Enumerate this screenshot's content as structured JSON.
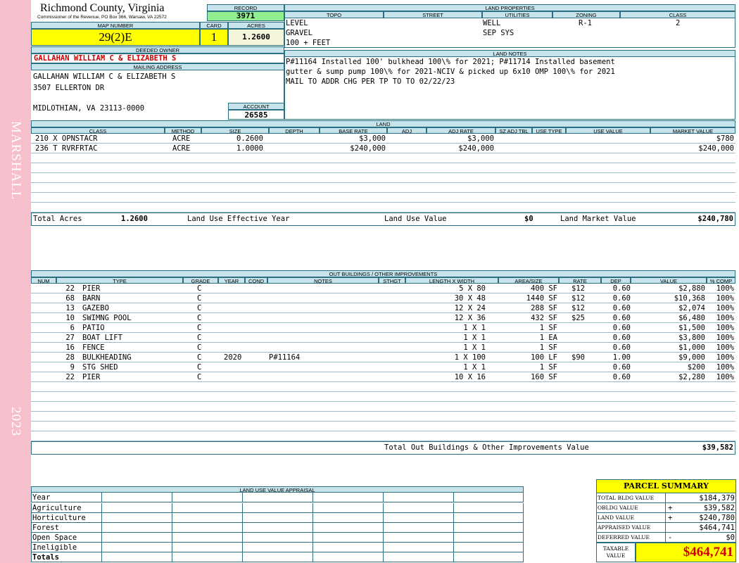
{
  "side": {
    "top_text": "MARSHALL",
    "bottom_text": "2023"
  },
  "header": {
    "county": "Richmond County, Virginia",
    "commissioner": "Commissioner of the Revenue, PO Box 366, Warsaw, VA 22572",
    "record_label": "RECORD",
    "record": "3971",
    "map_number_label": "MAP NUMBER",
    "map_number": "29(2)E",
    "card_label": "CARD",
    "card": "1",
    "acres_label": "ACRES",
    "acres": "1.2600"
  },
  "owner": {
    "deeded_label": "DEEDED OWNER",
    "deeded": "GALLAHAN WILLIAM C & ELIZABETH S",
    "mailing_label": "MAILING ADDRESS",
    "line1": "GALLAHAN WILLIAM C & ELIZABETH S",
    "line2": "3507 ELLERTON DR",
    "line3": "MIDLOTHIAN, VA 23113-0000",
    "account_label": "ACCOUNT",
    "account": "26585"
  },
  "land_properties": {
    "title": "LAND PROPERTIES",
    "headers": [
      "TOPO",
      "STREET",
      "UTILITIES",
      "ZONING",
      "CLASS"
    ],
    "topo": [
      "LEVEL",
      "GRAVEL",
      "100 + FEET"
    ],
    "utilities": [
      "WELL",
      "SEP SYS"
    ],
    "zoning": "R-1",
    "class": "2"
  },
  "land_notes": {
    "title": "LAND NOTES",
    "lines": [
      "P#11164 Installed 100' bulkhead 100\\% for 2021; P#11714 Installed basement",
      "gutter & sump pump 100\\% for 2021-NCIV & picked up 6x10 OMP 100\\% for 2021",
      "MAIL TO ADDR CHG PER TP TO TO 02/22/23"
    ]
  },
  "land": {
    "title": "LAND",
    "headers": [
      "CLASS",
      "METHOD",
      "SIZE",
      "DEPTH",
      "BASE RATE",
      "ADJ",
      "ADJ RATE",
      "SZ ADJ TBL",
      "USE TYPE",
      "USE VALUE",
      "MARKET VALUE"
    ],
    "rows": [
      {
        "class": "210 X OPNSTACR",
        "method": "ACRE",
        "size": "0.2600",
        "base_rate": "$3,000",
        "adj_rate": "$3,000",
        "market": "$780"
      },
      {
        "class": "236 T RVRFRTAC",
        "method": "ACRE",
        "size": "1.0000",
        "base_rate": "$240,000",
        "adj_rate": "$240,000",
        "market": "$240,000"
      }
    ],
    "total_acres_label": "Total Acres",
    "total_acres": "1.2600",
    "effective_label": "Land Use Effective Year",
    "use_value_label": "Land Use Value",
    "use_value": "$0",
    "market_label": "Land Market Value",
    "market_value": "$240,780"
  },
  "outbuildings": {
    "title": "OUT BUILDINGS / OTHER IMPROVEMENTS",
    "headers": [
      "NUM",
      "TYPE",
      "GRADE",
      "YEAR",
      "COND",
      "NOTES",
      "STHGT",
      "LENGTH X WIDTH",
      "AREA/SIZE",
      "RATE",
      "DEP",
      "VALUE",
      "% COMP"
    ],
    "rows": [
      {
        "num": "22",
        "type": "PIER",
        "grade": "C",
        "year": "",
        "notes": "",
        "lw": "5 X 80",
        "area": "400 SF",
        "rate": "$12",
        "dep": "0.60",
        "value": "$2,880",
        "comp": "100%"
      },
      {
        "num": "68",
        "type": "BARN",
        "grade": "C",
        "year": "",
        "notes": "",
        "lw": "30 X 48",
        "area": "1440 SF",
        "rate": "$12",
        "dep": "0.60",
        "value": "$10,368",
        "comp": "100%"
      },
      {
        "num": "13",
        "type": "GAZEBO",
        "grade": "C",
        "year": "",
        "notes": "",
        "lw": "12 X 24",
        "area": "288 SF",
        "rate": "$12",
        "dep": "0.60",
        "value": "$2,074",
        "comp": "100%"
      },
      {
        "num": "10",
        "type": "SWIMNG POOL",
        "grade": "C",
        "year": "",
        "notes": "",
        "lw": "12 X 36",
        "area": "432 SF",
        "rate": "$25",
        "dep": "0.60",
        "value": "$6,480",
        "comp": "100%"
      },
      {
        "num": "6",
        "type": "PATIO",
        "grade": "C",
        "year": "",
        "notes": "",
        "lw": "1 X 1",
        "area": "1 SF",
        "rate": "",
        "dep": "0.60",
        "value": "$1,500",
        "comp": "100%"
      },
      {
        "num": "27",
        "type": "BOAT LIFT",
        "grade": "C",
        "year": "",
        "notes": "",
        "lw": "1 X 1",
        "area": "1 EA",
        "rate": "",
        "dep": "0.60",
        "value": "$3,800",
        "comp": "100%"
      },
      {
        "num": "16",
        "type": "FENCE",
        "grade": "C",
        "year": "",
        "notes": "",
        "lw": "1 X 1",
        "area": "1 SF",
        "rate": "",
        "dep": "0.60",
        "value": "$1,000",
        "comp": "100%"
      },
      {
        "num": "28",
        "type": "BULKHEADING",
        "grade": "C",
        "year": "2020",
        "notes": "P#11164",
        "lw": "1 X 100",
        "area": "100 LF",
        "rate": "$90",
        "dep": "1.00",
        "value": "$9,000",
        "comp": "100%"
      },
      {
        "num": "9",
        "type": "STG SHED",
        "grade": "C",
        "year": "",
        "notes": "",
        "lw": "1 X 1",
        "area": "1 SF",
        "rate": "",
        "dep": "0.60",
        "value": "$200",
        "comp": "100%"
      },
      {
        "num": "22",
        "type": "PIER",
        "grade": "C",
        "year": "",
        "notes": "",
        "lw": "10 X 16",
        "area": "160 SF",
        "rate": "",
        "dep": "0.60",
        "value": "$2,280",
        "comp": "100%"
      }
    ],
    "total_label": "Total Out Buildings & Other Improvements Value",
    "total": "$39,582"
  },
  "land_use_appraisal": {
    "title": "LAND USE VALUE APPRAISAL",
    "rows": [
      "Year",
      "Agriculture",
      "Horticulture",
      "Forest",
      "Open Space",
      "Ineligible",
      "Totals"
    ]
  },
  "summary": {
    "title": "PARCEL SUMMARY",
    "rows": [
      {
        "label": "TOTAL BLDG VALUE",
        "sign": "",
        "value": "$184,379"
      },
      {
        "label": "OBLDG VALUE",
        "sign": "+",
        "value": "$39,582"
      },
      {
        "label": "LAND VALUE",
        "sign": "+",
        "value": "$240,780"
      },
      {
        "label": "APPRAISED VALUE",
        "sign": "",
        "value": "$464,741"
      },
      {
        "label": "DEFERRED VALUE",
        "sign": "-",
        "value": "$0"
      }
    ],
    "taxable_label": "TAXABLE VALUE",
    "taxable": "$464,741"
  },
  "colors": {
    "sidebar": "#f5c0cc",
    "header": "#c7e3ec",
    "yellow": "#ffff00",
    "green": "#90ee90",
    "red": "#cc0000"
  }
}
